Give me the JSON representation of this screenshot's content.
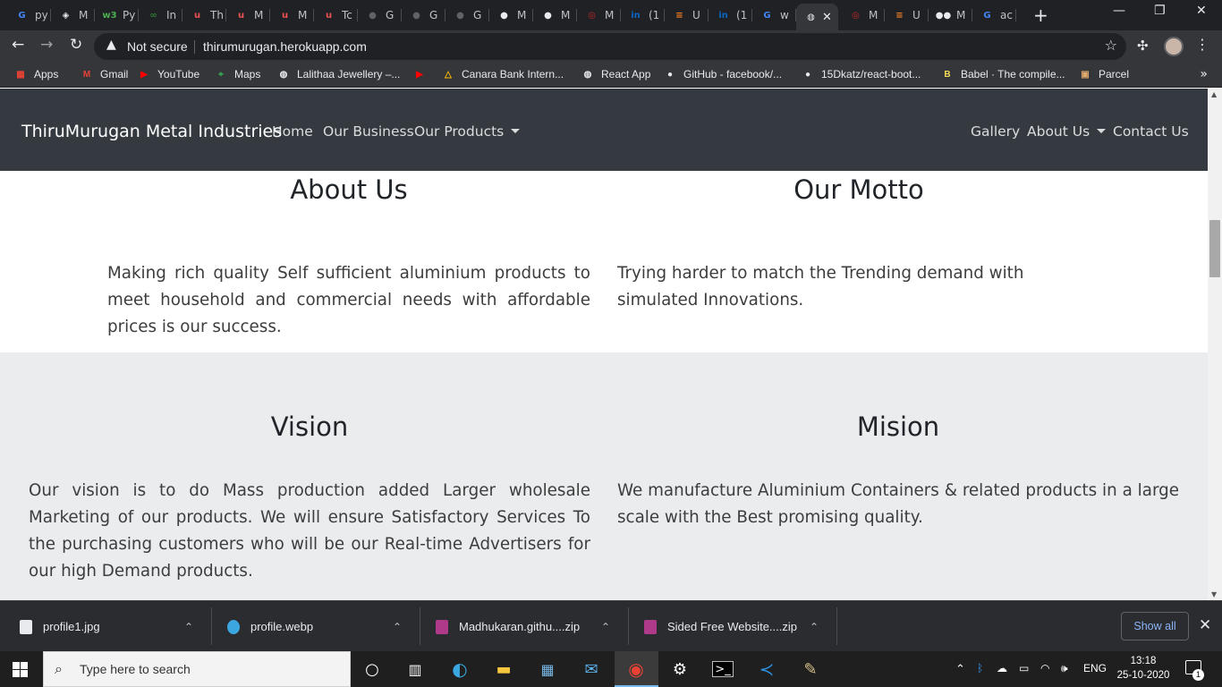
{
  "browser": {
    "tabs": [
      {
        "title": "py",
        "icon": "google-icon",
        "color": "#4285f4",
        "glyph": "G"
      },
      {
        "title": "M",
        "icon": "diamond-icon",
        "color": "#e8eaed",
        "glyph": "◈"
      },
      {
        "title": "Py",
        "icon": "w3schools-icon",
        "color": "#4caf50",
        "glyph": "w3"
      },
      {
        "title": "In",
        "icon": "link-icon",
        "color": "#2e7d32",
        "glyph": "∞"
      },
      {
        "title": "Th",
        "icon": "udemy-icon",
        "color": "#ec5252",
        "glyph": "u"
      },
      {
        "title": "M",
        "icon": "udemy-icon",
        "color": "#ec5252",
        "glyph": "u"
      },
      {
        "title": "M",
        "icon": "udemy-icon",
        "color": "#ec5252",
        "glyph": "u"
      },
      {
        "title": "Tc",
        "icon": "udemy-icon",
        "color": "#ec5252",
        "glyph": "u"
      },
      {
        "title": "G",
        "icon": "github-icon",
        "color": "#5f6368",
        "glyph": "●"
      },
      {
        "title": "G",
        "icon": "github-icon",
        "color": "#5f6368",
        "glyph": "●"
      },
      {
        "title": "G",
        "icon": "github-icon",
        "color": "#5f6368",
        "glyph": "●"
      },
      {
        "title": "M",
        "icon": "github-icon",
        "color": "#e8eaed",
        "glyph": "●"
      },
      {
        "title": "M",
        "icon": "github-icon",
        "color": "#e8eaed",
        "glyph": "●"
      },
      {
        "title": "M",
        "icon": "rocket-icon",
        "color": "#c62828",
        "glyph": "◎"
      },
      {
        "title": "(1",
        "icon": "linkedin-icon",
        "color": "#0a66c2",
        "glyph": "in"
      },
      {
        "title": "U",
        "icon": "stackoverflow-icon",
        "color": "#f48024",
        "glyph": "≡"
      },
      {
        "title": "(1",
        "icon": "linkedin-icon",
        "color": "#0a66c2",
        "glyph": "in"
      },
      {
        "title": "w",
        "icon": "google-icon",
        "color": "#4285f4",
        "glyph": "G"
      },
      {
        "title": "",
        "icon": "globe-icon",
        "color": "#e8eaed",
        "glyph": "◍",
        "active": true
      },
      {
        "title": "M",
        "icon": "rocket-icon",
        "color": "#c62828",
        "glyph": "◎"
      },
      {
        "title": "U",
        "icon": "stackoverflow-icon",
        "color": "#f48024",
        "glyph": "≡"
      },
      {
        "title": "M",
        "icon": "medium-icon",
        "color": "#e8eaed",
        "glyph": "●●"
      },
      {
        "title": "ac",
        "icon": "google-icon",
        "color": "#4285f4",
        "glyph": "G"
      }
    ],
    "security_label": "Not secure",
    "url": "thirumurugan.herokuapp.com",
    "bookmarks": [
      {
        "label": "Apps",
        "icon": "apps-grid-icon",
        "color": "#ea4335"
      },
      {
        "label": "Gmail",
        "icon": "gmail-icon",
        "color": "#ea4335"
      },
      {
        "label": "YouTube",
        "icon": "youtube-icon",
        "color": "#ff0000"
      },
      {
        "label": "Maps",
        "icon": "maps-icon",
        "color": "#34a853"
      },
      {
        "label": "Lalithaa Jewellery –...",
        "icon": "globe-icon",
        "color": "#e8eaed"
      },
      {
        "label": "",
        "icon": "youtube-icon",
        "color": "#ff0000"
      },
      {
        "label": "Canara Bank Intern...",
        "icon": "canara-icon",
        "color": "#fbbc04"
      },
      {
        "label": "React App",
        "icon": "globe-icon",
        "color": "#e8eaed"
      },
      {
        "label": "GitHub - facebook/...",
        "icon": "github-icon",
        "color": "#e8eaed"
      },
      {
        "label": "15Dkatz/react-boot...",
        "icon": "github-icon",
        "color": "#e8eaed"
      },
      {
        "label": "Babel · The compile...",
        "icon": "babel-icon",
        "color": "#f5da55"
      },
      {
        "label": "Parcel",
        "icon": "parcel-icon",
        "color": "#e0a96d"
      }
    ]
  },
  "site": {
    "brand": "ThiruMurugan Metal Industries",
    "nav": {
      "home": "Home",
      "business": "Our Business",
      "products": "Our Products",
      "gallery": "Gallery",
      "about": "About Us",
      "contact": "Contact Us"
    },
    "about": {
      "title": "About Us",
      "text": "Making rich quality Self sufficient aluminium products to meet household and commercial needs with affordable prices is our success."
    },
    "motto": {
      "title": "Our Motto",
      "text": "Trying harder to match the Trending demand with simulated Innovations."
    },
    "vision": {
      "title": "Vision",
      "text": "Our vision is to do Mass production added Larger wholesale Marketing of our products. We will ensure Satisfactory Services To the purchasing customers who will be our Real-time Advertisers for our high Demand products."
    },
    "mission": {
      "title": "Mision",
      "text": "We manufacture Aluminium Containers & related products in a large scale with the Best promising quality."
    }
  },
  "downloads": {
    "items": [
      {
        "name": "profile1.jpg",
        "icon": "file-icon"
      },
      {
        "name": "profile.webp",
        "icon": "edge-icon"
      },
      {
        "name": "Madhukaran.githu....zip",
        "icon": "winrar-icon"
      },
      {
        "name": "Sided Free Website....zip",
        "icon": "winrar-icon"
      }
    ],
    "show_all": "Show all"
  },
  "taskbar": {
    "search_placeholder": "Type here to search",
    "language": "ENG",
    "time": "13:18",
    "date": "25-10-2020",
    "notifications": "1"
  }
}
